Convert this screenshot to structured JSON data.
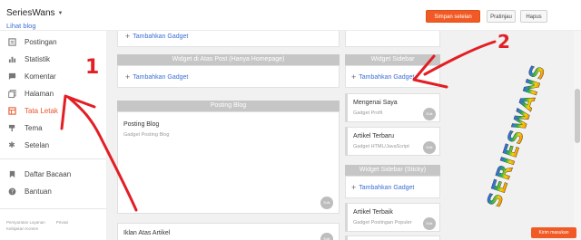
{
  "header": {
    "blog_name": "SeriesWans",
    "view_blog": "Lihat blog",
    "save_label": "Simpan setelan",
    "preview_label": "Pratinjau",
    "discard_label": "Hapus"
  },
  "sidebar": {
    "items": [
      {
        "label": "Postingan",
        "icon": "posts-icon"
      },
      {
        "label": "Statistik",
        "icon": "stats-icon"
      },
      {
        "label": "Komentar",
        "icon": "comments-icon"
      },
      {
        "label": "Halaman",
        "icon": "pages-icon"
      },
      {
        "label": "Tata Letak",
        "icon": "layout-icon",
        "active": true
      },
      {
        "label": "Tema",
        "icon": "theme-icon"
      },
      {
        "label": "Setelan",
        "icon": "settings-icon"
      }
    ],
    "secondary": [
      {
        "label": "Daftar Bacaan",
        "icon": "bookmark-icon"
      },
      {
        "label": "Bantuan",
        "icon": "help-icon"
      }
    ],
    "footer": {
      "terms": "Persyaratan Layanan",
      "privacy": "Privasi",
      "content_policy": "Kebijakan Konten"
    }
  },
  "layout": {
    "top_add": "Tambahkan Gadget",
    "above_post": {
      "title": "Widget di Atas Post (Hanya Homepage)",
      "add": "Tambahkan Gadget"
    },
    "posting": {
      "title": "Posting Blog",
      "gadget_title": "Posting Blog",
      "gadget_sub": "Gadget Posting Blog",
      "edit": "Edit"
    },
    "iklan": {
      "title": "Iklan Atas Artikel",
      "edit": "Edit"
    },
    "widget_sidebar": {
      "title": "Widget Sidebar",
      "add": "Tambahkan Gadget",
      "gadgets": [
        {
          "title": "Mengenai Saya",
          "sub": "Gadget Profil",
          "edit": "Edit"
        },
        {
          "title": "Artikel Terbaru",
          "sub": "Gadget HTML/JavaScript",
          "edit": "Edit"
        }
      ]
    },
    "sticky": {
      "title": "Widget Sidebar (Sticky)",
      "add": "Tambahkan Gadget",
      "gadgets": [
        {
          "title": "Artikel Terbaik",
          "sub": "Gadget Postingan Populer",
          "edit": "Edit"
        }
      ]
    }
  },
  "annotations": {
    "number_one": "1",
    "number_two": "2",
    "watermark": "SERIESWANS",
    "arrow_color": "#e31e24"
  },
  "feedback_label": "Kirim masukan",
  "colors": {
    "accent": "#f15a24",
    "link": "#3b6fd4",
    "section_header": "#c6c6c6"
  }
}
